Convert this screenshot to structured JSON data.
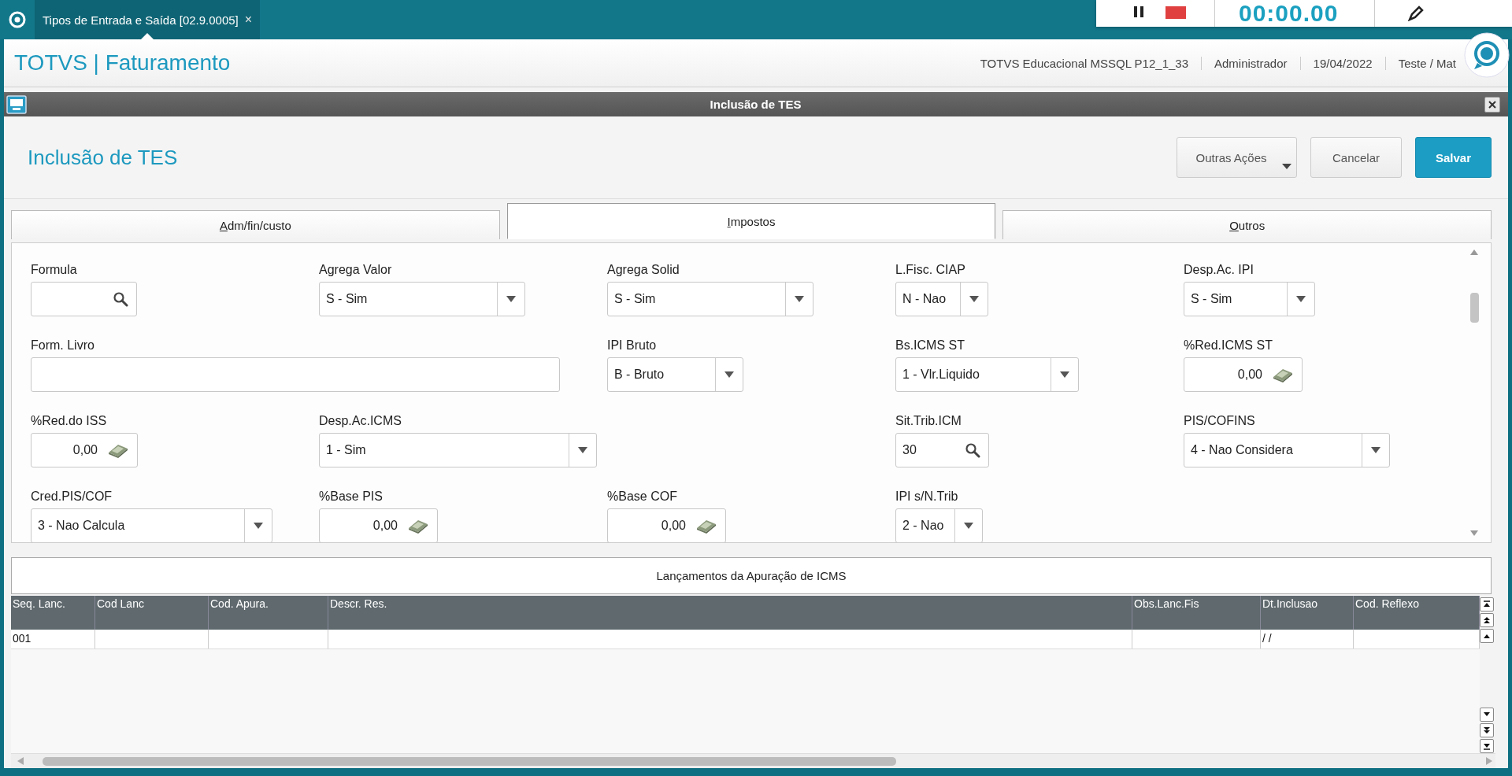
{
  "app_tabs": [
    {
      "label": "Tipos de Entrada e Saída [02.9.0005]",
      "close": "×",
      "selected": true
    }
  ],
  "recorder": {
    "timer": "00:00.00"
  },
  "header": {
    "title": "TOTVS | Faturamento",
    "info": [
      "TOTVS Educacional MSSQL P12_1_33",
      "Administrador",
      "19/04/2022",
      "Teste / Mat"
    ]
  },
  "dialog": {
    "title": "Inclusão de TES"
  },
  "page": {
    "title": "Inclusão de TES",
    "buttons": [
      {
        "label": "Outras Ações",
        "kind": "menu"
      },
      {
        "label": "Cancelar",
        "kind": "default"
      },
      {
        "label": "Salvar",
        "kind": "primary"
      }
    ]
  },
  "tabs": [
    {
      "label": "Adm/fin/custo",
      "selected": false
    },
    {
      "label": "Impostos",
      "selected": true
    },
    {
      "label": "Outros",
      "selected": false
    }
  ],
  "form": {
    "rows": [
      [
        {
          "label": "Formula",
          "kind": "lookup"
        },
        {
          "label": "Agrega Valor",
          "kind": "select",
          "value": "S - Sim"
        },
        {
          "label": "Agrega Solid",
          "kind": "select",
          "value": "S - Sim"
        },
        {
          "label": "L.Fisc. CIAP",
          "kind": "select",
          "value": "N - Nao"
        },
        {
          "label": "Desp.Ac. IPI",
          "kind": "select",
          "value": "S - Sim"
        }
      ],
      [
        {
          "label": "Form. Livro",
          "kind": "text"
        },
        "",
        {
          "label": "IPI Bruto",
          "kind": "select",
          "value": "B - Bruto"
        },
        {
          "label": "Bs.ICMS ST",
          "kind": "select",
          "value": "1 - Vlr.Liquido"
        },
        {
          "label": "%Red.ICMS ST",
          "kind": "number",
          "value": "0,00"
        }
      ],
      [
        {
          "label": "%Red.do ISS",
          "kind": "number",
          "value": "0,00"
        },
        {
          "label": "Desp.Ac.ICMS",
          "kind": "select",
          "value": "1 - Sim"
        },
        "",
        {
          "label": "Sit.Trib.ICM",
          "kind": "lookup",
          "value": "30"
        },
        {
          "label": "PIS/COFINS",
          "kind": "select",
          "value": "4 - Nao Considera"
        }
      ],
      [
        {
          "label": "Cred.PIS/COF",
          "kind": "select",
          "value": "3 - Nao Calcula"
        },
        {
          "label": "%Base PIS",
          "kind": "number",
          "value": "0,00"
        },
        {
          "label": "%Base COF",
          "kind": "number",
          "value": "0,00"
        },
        {
          "label": "IPI s/N.Trib",
          "kind": "select",
          "value": "2 - Nao"
        }
      ]
    ]
  },
  "grid": {
    "title": "Lançamentos da Apuração de ICMS",
    "columns": [
      "Seq. Lanc.",
      "Cod Lanc",
      "Cod. Apura.",
      "Descr. Res.",
      "Obs.Lanc.Fis",
      "Dt.Inclusao",
      "Cod. Reflexo"
    ],
    "rows": [
      {
        "cells": [
          "001",
          null,
          null,
          null,
          null,
          "/ /",
          null
        ]
      }
    ]
  }
}
